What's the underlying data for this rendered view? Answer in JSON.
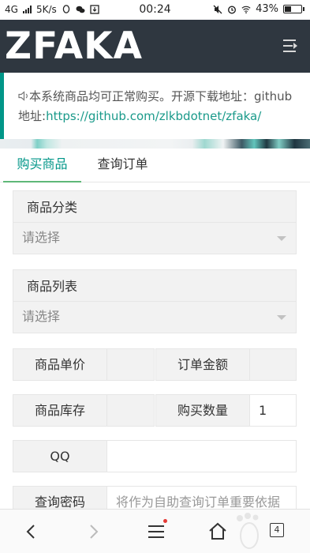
{
  "status_bar": {
    "network": "4G",
    "speed": "5K/s",
    "time": "00:24",
    "battery": "43%",
    "battery_level": 0.43
  },
  "header": {
    "logo": "ZFAKA",
    "menu_icon": "menu-fold-icon"
  },
  "notice": {
    "icon": "speaker-icon",
    "text": "本系统商品均可正常购买。开源下载地址：github地址:",
    "link": "https://github.com/zlkbdotnet/zfaka/"
  },
  "tabs": [
    {
      "label": "购买商品",
      "active": true
    },
    {
      "label": "查询订单",
      "active": false
    }
  ],
  "form": {
    "category": {
      "label": "商品分类",
      "select_value": "请选择"
    },
    "product": {
      "label": "商品列表",
      "select_value": "请选择"
    },
    "unit_price": {
      "label": "商品单价",
      "value": ""
    },
    "order_amount": {
      "label": "订单金额",
      "value": ""
    },
    "stock": {
      "label": "商品库存",
      "value": ""
    },
    "quantity": {
      "label": "购买数量",
      "value": "1"
    },
    "qq": {
      "label": "QQ",
      "value": ""
    },
    "query_password": {
      "label": "查询密码",
      "placeholder": "将作为自助查询订单重要依据"
    }
  },
  "browser_nav": {
    "tabs_count": "4",
    "icons": [
      "back-icon",
      "forward-icon",
      "menu-icon",
      "home-icon",
      "tabs-icon"
    ],
    "accent_color": "#009688"
  }
}
